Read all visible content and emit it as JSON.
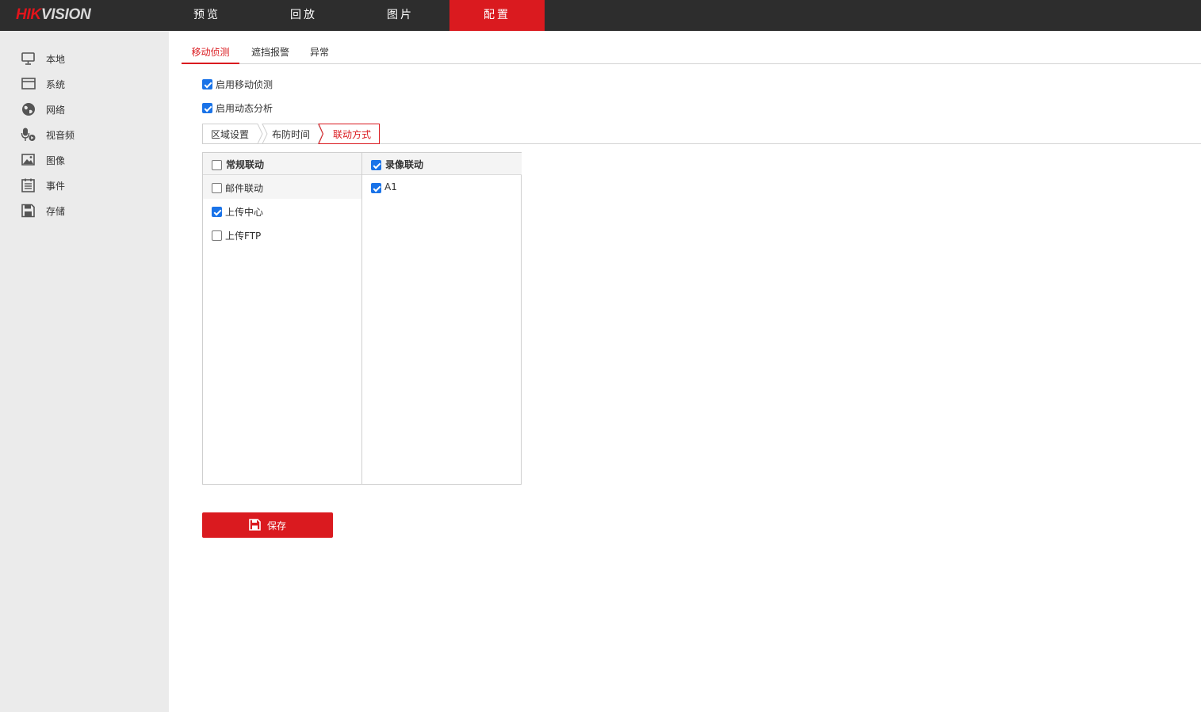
{
  "brand": {
    "logo_red": "HIK",
    "logo_rest": "VISION"
  },
  "top_nav": [
    {
      "label": "预览"
    },
    {
      "label": "回放"
    },
    {
      "label": "图片"
    },
    {
      "label": "配置",
      "active": true
    }
  ],
  "sidebar": {
    "items": [
      {
        "label": "本地",
        "icon": "monitor-icon"
      },
      {
        "label": "系统",
        "icon": "window-icon"
      },
      {
        "label": "网络",
        "icon": "globe-icon"
      },
      {
        "label": "视音频",
        "icon": "microphone-icon"
      },
      {
        "label": "图像",
        "icon": "image-icon"
      },
      {
        "label": "事件",
        "icon": "calendar-list-icon"
      },
      {
        "label": "存储",
        "icon": "floppy-disk-icon"
      }
    ]
  },
  "tabs": [
    {
      "label": "移动侦测",
      "active": true
    },
    {
      "label": "遮挡报警"
    },
    {
      "label": "异常"
    }
  ],
  "options": {
    "enable_motion": {
      "label": "启用移动侦测",
      "checked": true
    },
    "enable_dynamic": {
      "label": "启用动态分析",
      "checked": true
    }
  },
  "subtabs": [
    {
      "label": "区域设置"
    },
    {
      "label": "布防时间"
    },
    {
      "label": "联动方式",
      "active": true
    }
  ],
  "linkage": {
    "normal": {
      "header": {
        "label": "常规联动",
        "checked": false
      },
      "items": [
        {
          "label": "邮件联动",
          "checked": false
        },
        {
          "label": "上传中心",
          "checked": true
        },
        {
          "label": "上传FTP",
          "checked": false
        }
      ]
    },
    "record": {
      "header": {
        "label": "录像联动",
        "checked": true
      },
      "items": [
        {
          "label": "A1",
          "checked": true
        }
      ]
    }
  },
  "save_button": {
    "label": "保存",
    "icon": "save-icon"
  },
  "colors": {
    "accent": "#da1a1f",
    "topbar": "#2d2d2d",
    "sidebar": "#ebebeb",
    "checkbox": "#1a73e8"
  }
}
